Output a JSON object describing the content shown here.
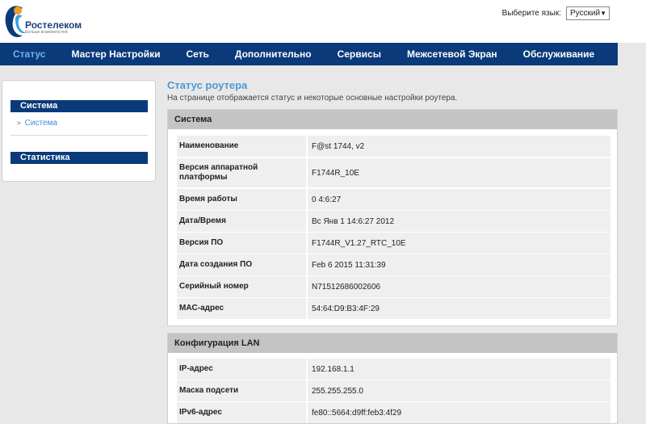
{
  "brand": {
    "name": "Ростелеком",
    "tagline": "Больше возможностей",
    "colors": {
      "navy": "#0a3a7a",
      "accent": "#4a9ad8",
      "orange": "#f29d22"
    }
  },
  "lang": {
    "label": "Выберите язык:",
    "selected": "Русский"
  },
  "nav": [
    "Статус",
    "Мастер Настройки",
    "Сеть",
    "Дополнительно",
    "Сервисы",
    "Межсетевой Экран",
    "Обслуживание"
  ],
  "sidebar": {
    "section1": "Система",
    "item1": "Система",
    "section2": "Статистика"
  },
  "page": {
    "title": "Статус роутера",
    "subtitle": "На странице отображается статус и некоторые основные настройки роутера."
  },
  "system": {
    "title": "Система",
    "rows": [
      {
        "label": "Наименование",
        "value": "F@st 1744, v2"
      },
      {
        "label": "Версия аппаратной платформы",
        "value": "F1744R_10E"
      },
      {
        "label": "Время работы",
        "value": "0 4:6:27"
      },
      {
        "label": "Дата/Время",
        "value": "Вс Янв 1 14:6:27 2012"
      },
      {
        "label": "Версия ПО",
        "value": "F1744R_V1.27_RTC_10E"
      },
      {
        "label": "Дата создания ПО",
        "value": "Feb 6 2015 11:31:39"
      },
      {
        "label": "Серийный номер",
        "value": "N71512686002606"
      },
      {
        "label": "MAC-адрес",
        "value": "54:64:D9:B3:4F:29"
      }
    ]
  },
  "lan": {
    "title": "Конфигурация LAN",
    "rows": [
      {
        "label": "IP-адрес",
        "value": "192.168.1.1"
      },
      {
        "label": "Маска подсети",
        "value": "255.255.255.0"
      },
      {
        "label": "IPv6-адрес",
        "value": "fe80::5664:d9ff:feb3:4f29"
      }
    ]
  }
}
